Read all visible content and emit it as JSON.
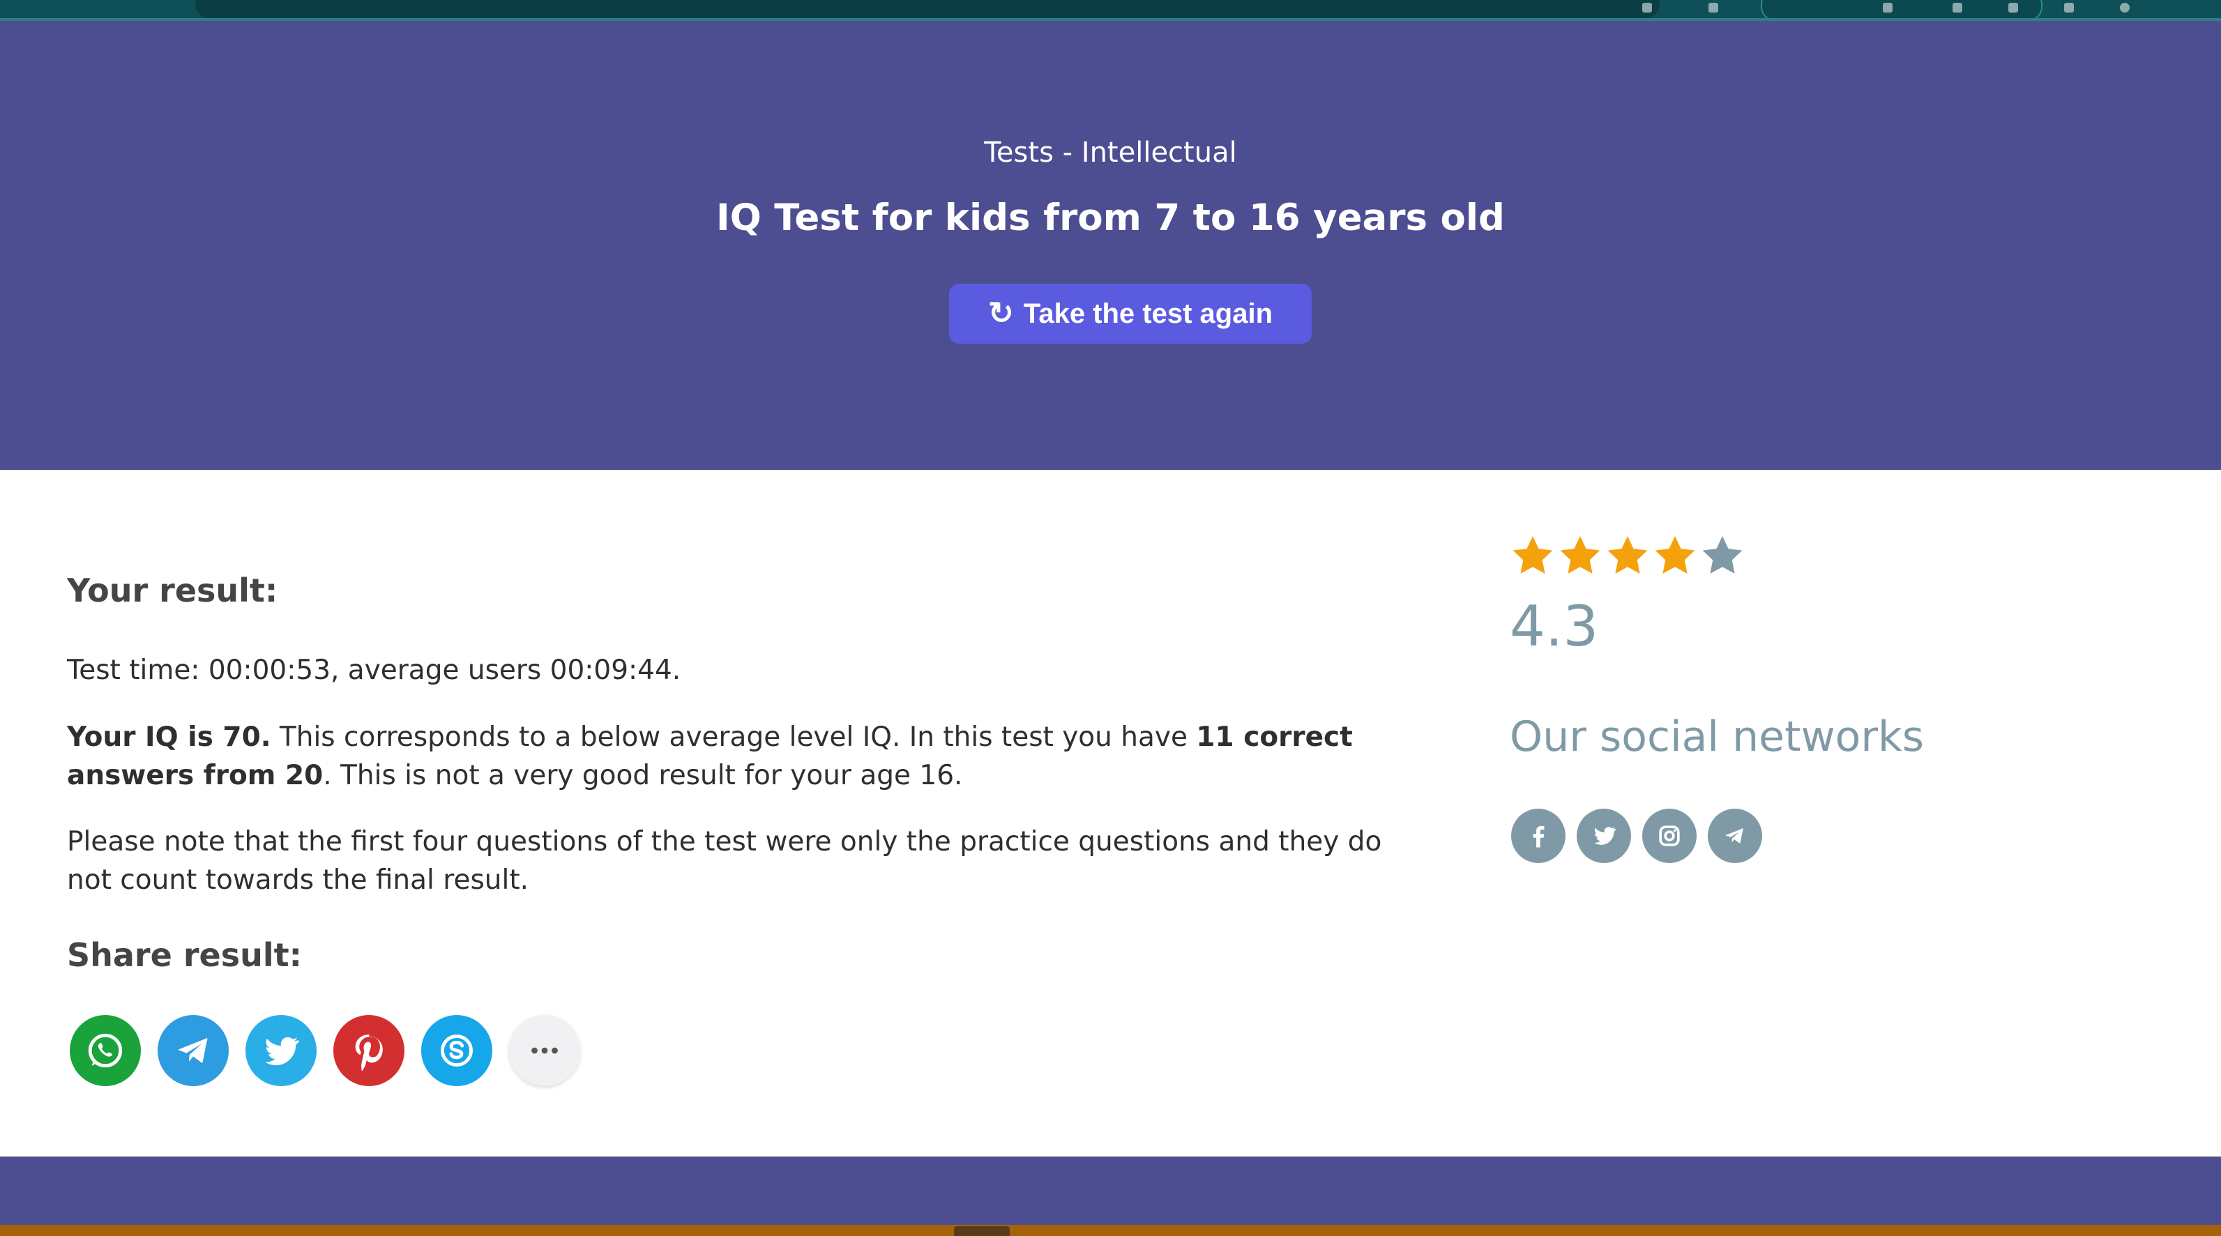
{
  "hero": {
    "category": "Tests - Intellectual",
    "title": "IQ Test for kids from 7 to 16 years old",
    "retake_button": "Take the test again",
    "retake_icon": "refresh-icon"
  },
  "result": {
    "heading": "Your result:",
    "time_text": "Test time: 00:00:53, average users 00:09:44.",
    "iq_bold": "Your IQ is 70.",
    "iq_text_1": " This corresponds to a below average level IQ. In this test you have ",
    "correct_bold": "11 correct answers from 20",
    "iq_text_2": ". This is not a very good result for your age 16.",
    "note_text": "Please note that the first four questions of the test were only the practice questions and they do not count towards the final result.",
    "share_heading": "Share result:",
    "share_buttons": [
      {
        "name": "whatsapp",
        "icon": "whatsapp-icon",
        "color": "#1aa33a"
      },
      {
        "name": "telegram",
        "icon": "telegram-icon",
        "color": "#2d9ce0"
      },
      {
        "name": "twitter",
        "icon": "twitter-icon",
        "color": "#29aee8"
      },
      {
        "name": "pinterest",
        "icon": "pinterest-icon",
        "color": "#d42f30"
      },
      {
        "name": "skype",
        "icon": "skype-icon",
        "color": "#16a6ea"
      },
      {
        "name": "more",
        "icon": "more-icon",
        "color": "#f1f1f4"
      }
    ]
  },
  "sidebar": {
    "rating": {
      "value": "4.3",
      "stars_filled": 4,
      "stars_total": 5,
      "filled_color": "#f5a10c",
      "empty_color": "#7f9aa6"
    },
    "social_heading": "Our social networks",
    "social_links": [
      {
        "name": "facebook",
        "icon": "facebook-icon"
      },
      {
        "name": "twitter",
        "icon": "twitter-icon"
      },
      {
        "name": "instagram",
        "icon": "instagram-icon"
      },
      {
        "name": "telegram",
        "icon": "telegram-icon"
      }
    ]
  },
  "colors": {
    "hero_bg": "#4d4d91",
    "button_bg": "#5b5be0",
    "muted_text": "#7f9aa6"
  }
}
